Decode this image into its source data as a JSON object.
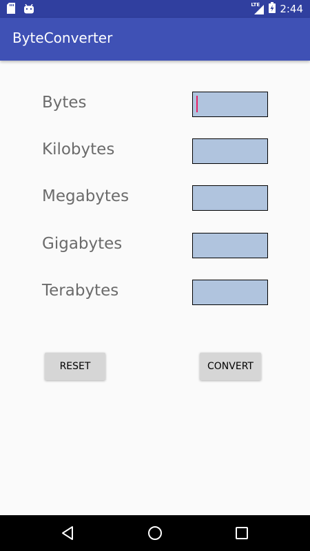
{
  "status_bar": {
    "time": "2:44",
    "network_label": "LTE",
    "icons": [
      "sd-card-icon",
      "android-icon",
      "lte-signal-icon",
      "battery-charging-icon"
    ]
  },
  "app": {
    "title": "ByteConverter"
  },
  "form": {
    "rows": [
      {
        "label": "Bytes",
        "value": ""
      },
      {
        "label": "Kilobytes",
        "value": ""
      },
      {
        "label": "Megabytes",
        "value": ""
      },
      {
        "label": "Gigabytes",
        "value": ""
      },
      {
        "label": "Terabytes",
        "value": ""
      }
    ]
  },
  "buttons": {
    "reset_label": "RESET",
    "convert_label": "CONVERT"
  },
  "nav_bar": {
    "icons": [
      "back-icon",
      "home-icon",
      "recents-icon"
    ]
  },
  "colors": {
    "status_bar": "#303F9F",
    "app_bar": "#3F51B5",
    "input_fill": "#B0C4DE",
    "cursor": "#E91E63",
    "button": "#D6D6D6"
  }
}
